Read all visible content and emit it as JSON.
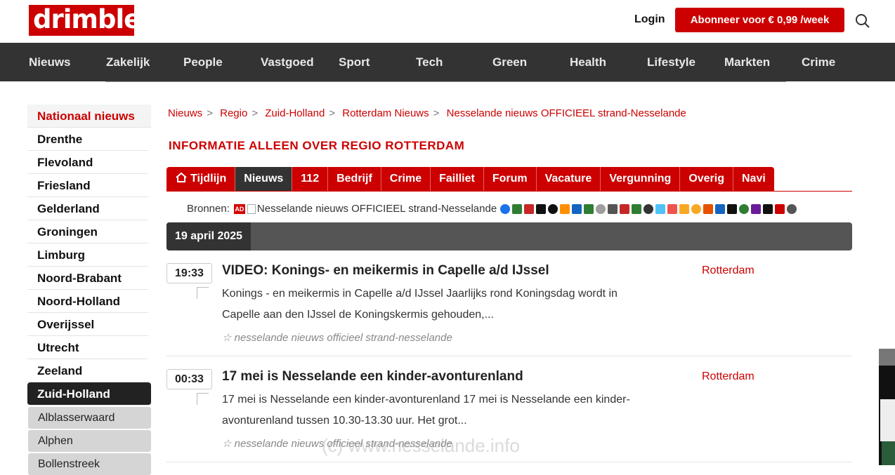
{
  "header": {
    "logo": "drimble",
    "login": "Login",
    "subscribe": "Abonneer voor € 0,99 /week"
  },
  "nav": [
    "Nieuws",
    "Zakelijk",
    "People",
    "Vastgoed",
    "Sport",
    "Tech",
    "Green",
    "Health",
    "Lifestyle",
    "Markten",
    "Crime"
  ],
  "sidebar": {
    "national": "Nationaal nieuws",
    "provinces": [
      "Drenthe",
      "Flevoland",
      "Friesland",
      "Gelderland",
      "Groningen",
      "Limburg",
      "Noord-Brabant",
      "Noord-Holland",
      "Overijssel",
      "Utrecht",
      "Zeeland"
    ],
    "active": "Zuid-Holland",
    "sub": [
      "Alblasserwaard",
      "Alphen",
      "Bollenstreek"
    ]
  },
  "breadcrumb": [
    "Nieuws",
    "Regio",
    "Zuid-Holland",
    "Rotterdam Nieuws",
    "Nesselande nieuws OFFICIEEL strand-Nesselande"
  ],
  "region_title": "INFORMATIE ALLEEN OVER REGIO ROTTERDAM",
  "tabs": [
    "Tijdlijn",
    "Nieuws",
    "112",
    "Bedrijf",
    "Crime",
    "Failliet",
    "Forum",
    "Vacature",
    "Vergunning",
    "Overig",
    "Navi"
  ],
  "sources": {
    "label": "Bronnen:",
    "first_badge": "AD",
    "alt_text": "Nesselande nieuws OFFICIEEL strand-Nesselande",
    "icon_colors": [
      "#1a73e8",
      "#2e7d32",
      "#c62828",
      "#111111",
      "#111111",
      "#ff8f00",
      "#1565c0",
      "#2e7d32",
      "#9e9e9e",
      "#555555",
      "#c62828",
      "#2e7d32",
      "#333333",
      "#4fc3f7",
      "#ef5350",
      "#f9a825",
      "#f9a825",
      "#e65100",
      "#1565c0",
      "#111111",
      "#2e7d32",
      "#6a1b9a",
      "#111111",
      "#cc0000",
      "#555555"
    ]
  },
  "date": "19 april 2025",
  "articles": [
    {
      "time": "19:33",
      "title": "VIDEO: Konings- en meikermis in Capelle a/d IJssel",
      "text": "Konings - en meikermis in Capelle a/d IJssel Jaarlijks rond Koningsdag wordt in Capelle aan den IJssel de Koningskermis gehouden,...",
      "tag": "☆ nesselande nieuws officieel strand-nesselande",
      "region": "Rotterdam"
    },
    {
      "time": "00:33",
      "title": "17 mei is Nesselande een kinder-avonturenland",
      "text": "17 mei is Nesselande een kinder-avonturenland 17 mei is Nesselande een kinder-avonturenland tussen 10.30-13.30 uur. Het grot...",
      "tag": "☆ nesselande nieuws officieel strand-nesselande",
      "region": "Rotterdam"
    }
  ],
  "watermark": "(c) www.nesselande.info"
}
